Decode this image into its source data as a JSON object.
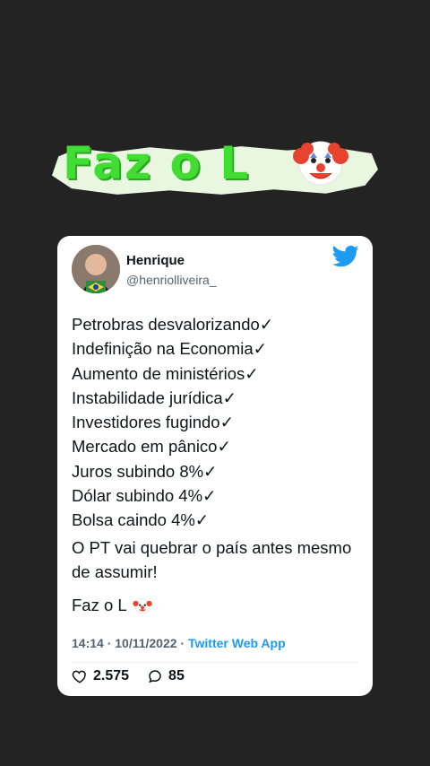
{
  "banner": {
    "title": "Faz o L",
    "icon": "clown-face-icon"
  },
  "tweet": {
    "author_name": "Henrique",
    "author_handle": "@henriolliveira_",
    "lines": [
      "Petrobras desvalorizando✓",
      "Indefinição na Economia✓",
      "Aumento de ministérios✓",
      "Instabilidade jurídica✓",
      "Investidores fugindo✓",
      "Mercado em pânico✓",
      "Juros subindo 8%✓",
      "Dólar subindo 4%✓",
      "Bolsa caindo 4%✓"
    ],
    "paragraph": "O PT vai quebrar o país antes mesmo de assumir!",
    "closing": "Faz o L",
    "timestamp": "14:14 · 10/11/2022 · ",
    "source": "Twitter Web App",
    "likes": "2.575",
    "replies": "85"
  },
  "colors": {
    "background": "#232323",
    "banner_text": "#42dd33",
    "twitter_blue": "#1d9bf0"
  }
}
